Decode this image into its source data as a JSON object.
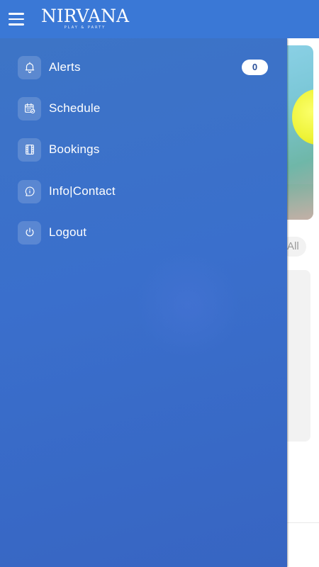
{
  "app": {
    "brand": "NIRVANA",
    "tagline": "PLAY & PARTY"
  },
  "colors": {
    "appbar": "#3a78d6",
    "drawer": "#3a6fcc",
    "badge_bg": "#ffffff"
  },
  "drawer": {
    "items": [
      {
        "label": "Alerts",
        "icon": "bell-icon",
        "badge": "0"
      },
      {
        "label": "Schedule",
        "icon": "calendar-icon"
      },
      {
        "label": "Bookings",
        "icon": "film-icon"
      },
      {
        "label": "Info|Contact",
        "icon": "chat-info-icon"
      },
      {
        "label": "Logout",
        "icon": "power-icon"
      }
    ]
  },
  "background": {
    "see_all_label": "All"
  }
}
